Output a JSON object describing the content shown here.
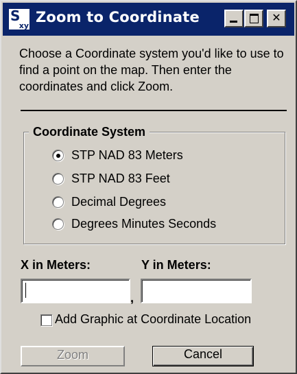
{
  "window": {
    "title": "Zoom to Coordinate",
    "icon": "xy-coordinate-icon",
    "icon_glyph": "S",
    "icon_sub": "xy"
  },
  "description": "Choose a Coordinate system you'd like to use to find a point on the map.  Then enter the coordinates and click Zoom.",
  "coordinate_system": {
    "legend": "Coordinate System",
    "options": [
      {
        "label": "STP NAD 83 Meters",
        "selected": true
      },
      {
        "label": "STP NAD 83 Feet",
        "selected": false
      },
      {
        "label": "Decimal Degrees",
        "selected": false
      },
      {
        "label": "Degrees Minutes Seconds",
        "selected": false
      }
    ]
  },
  "inputs": {
    "x_label": "X in Meters:",
    "y_label": "Y in Meters:",
    "x_value": "",
    "y_value": "",
    "separator": ","
  },
  "add_graphic": {
    "label": "Add Graphic at Coordinate Location",
    "checked": false
  },
  "buttons": {
    "zoom": "Zoom",
    "zoom_enabled": false,
    "cancel": "Cancel"
  },
  "colors": {
    "titlebar": "#0a246a",
    "face": "#d4d0c8"
  }
}
